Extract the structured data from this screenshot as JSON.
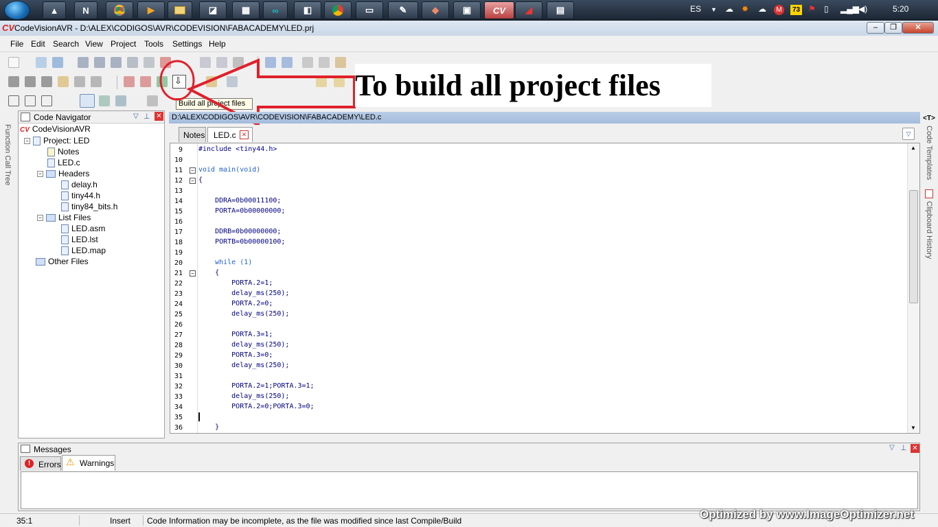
{
  "taskbar": {
    "language": "ES",
    "clock": "5:20",
    "badge": "73",
    "cv_label": "CV"
  },
  "window": {
    "title": "CodeVisionAVR - D:\\ALEX\\CODIGOS\\AVR\\CODEVISION\\FABACADEMY\\LED.prj",
    "app_logo": "CV"
  },
  "menu": {
    "items": [
      "File",
      "Edit",
      "Search",
      "View",
      "Project",
      "Tools",
      "Settings",
      "Help"
    ]
  },
  "annotation": {
    "text": "To  build all project files"
  },
  "tooltip": {
    "text": "Build all project files"
  },
  "navigator": {
    "title": "Code Navigator",
    "tree": {
      "root": "CodeVisionAVR",
      "project": "Project: LED",
      "notes": "Notes",
      "source": "LED.c",
      "headers": "Headers",
      "header_files": [
        "delay.h",
        "tiny44.h",
        "tiny84_bits.h"
      ],
      "list_files": "List Files",
      "list_items": [
        "LED.asm",
        "LED.lst",
        "LED.map"
      ],
      "other": "Other Files"
    }
  },
  "editor": {
    "path": "D:\\ALEX\\CODIGOS\\AVR\\CODEVISION\\FABACADEMY\\LED.c",
    "tabs": [
      "Notes",
      "LED.c"
    ],
    "lines": [
      {
        "n": "9",
        "t": "#include <tiny44.h>"
      },
      {
        "n": "10",
        "t": ""
      },
      {
        "n": "11",
        "t": "void main(void)"
      },
      {
        "n": "12",
        "t": "{"
      },
      {
        "n": "13",
        "t": ""
      },
      {
        "n": "14",
        "t": "    DDRA=0b00011100;"
      },
      {
        "n": "15",
        "t": "    PORTA=0b00000000;"
      },
      {
        "n": "16",
        "t": ""
      },
      {
        "n": "17",
        "t": "    DDRB=0b00000000;"
      },
      {
        "n": "18",
        "t": "    PORTB=0b00000100;"
      },
      {
        "n": "19",
        "t": ""
      },
      {
        "n": "20",
        "t": "    while (1)"
      },
      {
        "n": "21",
        "t": "    {"
      },
      {
        "n": "22",
        "t": "        PORTA.2=1;"
      },
      {
        "n": "23",
        "t": "        delay_ms(250);"
      },
      {
        "n": "24",
        "t": "        PORTA.2=0;"
      },
      {
        "n": "25",
        "t": "        delay_ms(250);"
      },
      {
        "n": "26",
        "t": ""
      },
      {
        "n": "27",
        "t": "        PORTA.3=1;"
      },
      {
        "n": "28",
        "t": "        delay_ms(250);"
      },
      {
        "n": "29",
        "t": "        PORTA.3=0;"
      },
      {
        "n": "30",
        "t": "        delay_ms(250);"
      },
      {
        "n": "31",
        "t": ""
      },
      {
        "n": "32",
        "t": "        PORTA.2=1;PORTA.3=1;"
      },
      {
        "n": "33",
        "t": "        delay_ms(250);"
      },
      {
        "n": "34",
        "t": "        PORTA.2=0;PORTA.3=0;"
      },
      {
        "n": "35",
        "t": ""
      },
      {
        "n": "36",
        "t": "    }"
      }
    ]
  },
  "side_panels": {
    "left": "Function Call Tree",
    "right_top": "Code Templates",
    "right_bottom": "Clipboard History",
    "right_icon": "<T>"
  },
  "messages": {
    "title": "Messages",
    "tabs": [
      "Errors",
      "Warnings"
    ]
  },
  "status": {
    "position": "35:1",
    "mode": "Insert",
    "info": "Code Information may be incomplete, as the file was modified since last Compile/Build"
  },
  "watermark": "Optimized by www.ImageOptimizer.net",
  "colors": {
    "accent": "#e0202a",
    "path_bar": "#a4bcdc",
    "keyword": "#1f5fd0"
  }
}
